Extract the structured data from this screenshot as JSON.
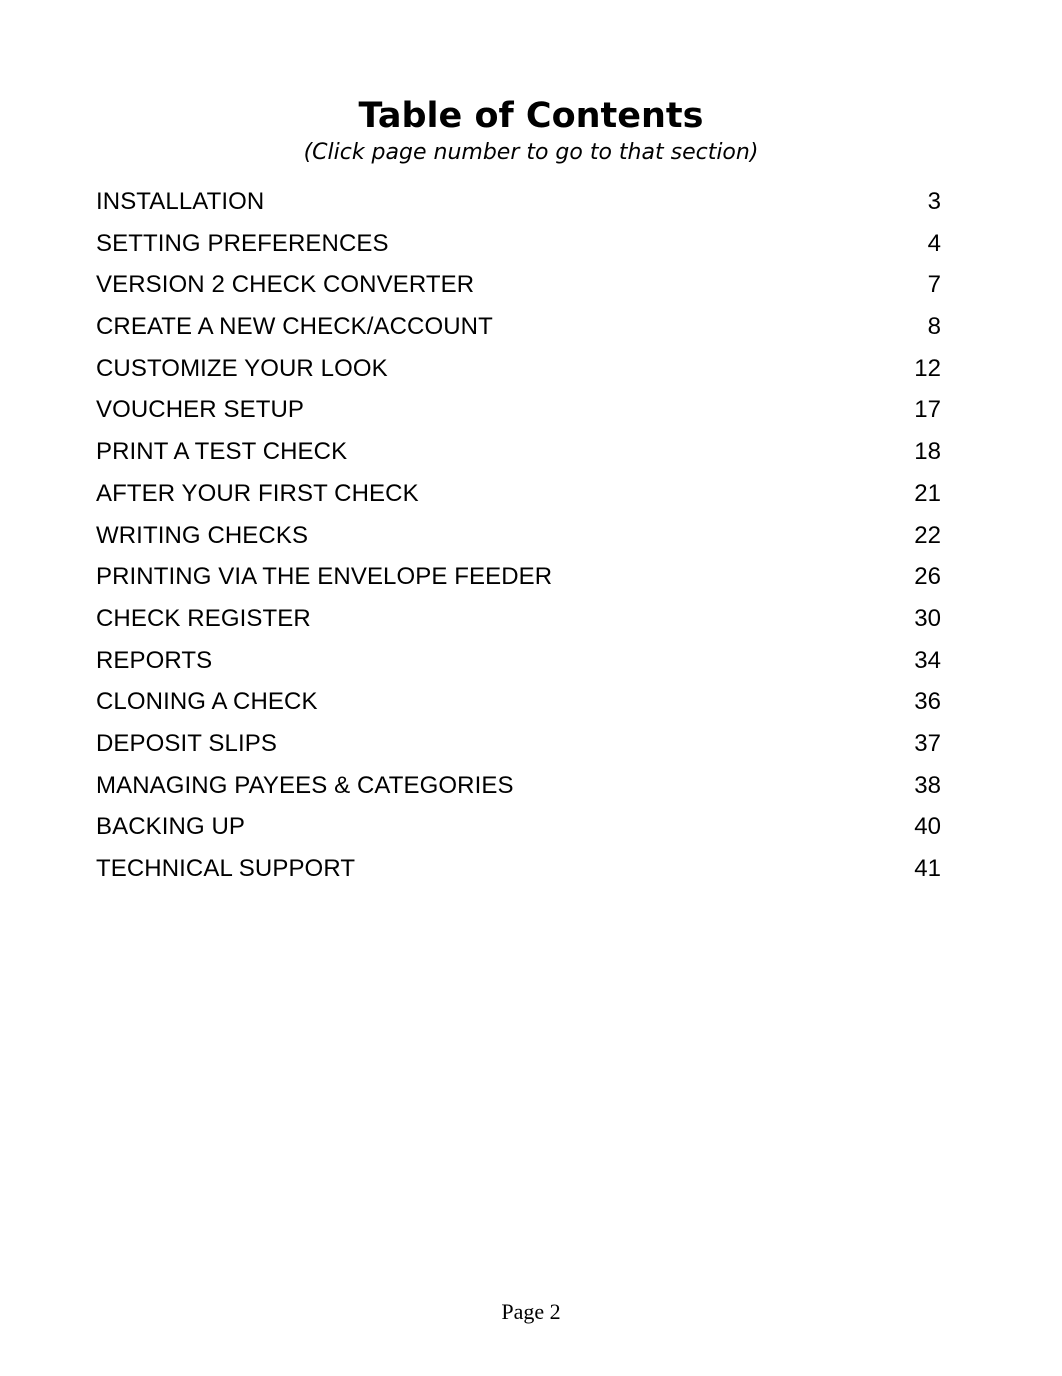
{
  "document": {
    "title": "Table of Contents",
    "subtitle": "(Click page number to go to that section)"
  },
  "toc": {
    "entries": [
      {
        "label": "INSTALLATION",
        "page": "3"
      },
      {
        "label": "SETTING PREFERENCES",
        "page": "4"
      },
      {
        "label": "VERSION 2 CHECK CONVERTER",
        "page": "7"
      },
      {
        "label": "CREATE A NEW CHECK/ACCOUNT",
        "page": "8"
      },
      {
        "label": "CUSTOMIZE YOUR LOOK",
        "page": "12"
      },
      {
        "label": "VOUCHER SETUP",
        "page": "17"
      },
      {
        "label": "PRINT A TEST CHECK",
        "page": "18"
      },
      {
        "label": "AFTER YOUR FIRST CHECK",
        "page": "21"
      },
      {
        "label": "WRITING CHECKS",
        "page": "22"
      },
      {
        "label": "PRINTING VIA THE ENVELOPE FEEDER",
        "page": "26"
      },
      {
        "label": "CHECK REGISTER",
        "page": "30"
      },
      {
        "label": "REPORTS",
        "page": "34"
      },
      {
        "label": "CLONING A CHECK",
        "page": "36"
      },
      {
        "label": "DEPOSIT SLIPS",
        "page": "37"
      },
      {
        "label": "MANAGING PAYEES & CATEGORIES",
        "page": "38"
      },
      {
        "label": "BACKING UP",
        "page": "40"
      },
      {
        "label": "TECHNICAL SUPPORT",
        "page": "41"
      }
    ]
  },
  "footer": {
    "page_label": "Page 2"
  },
  "colors": {
    "text": "#000000",
    "background": "#ffffff"
  }
}
